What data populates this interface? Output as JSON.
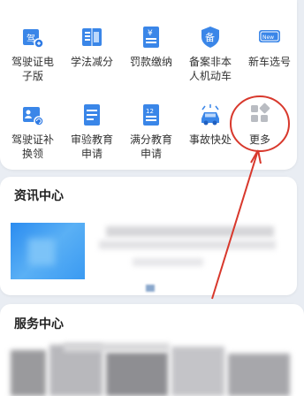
{
  "services": {
    "row1": [
      {
        "label_line1": "驾驶证电",
        "label_line2": "子版",
        "icon": "driving-license-card-icon"
      },
      {
        "label_line1": "学法减分",
        "label_line2": "",
        "icon": "book-icon"
      },
      {
        "label_line1": "罚款缴纳",
        "label_line2": "",
        "icon": "fine-payment-icon"
      },
      {
        "label_line1": "备案非本",
        "label_line2": "人机动车",
        "icon": "shield-icon"
      },
      {
        "label_line1": "新车选号",
        "label_line2": "",
        "icon": "new-plate-icon"
      }
    ],
    "row2": [
      {
        "label_line1": "驾驶证补",
        "label_line2": "换领",
        "icon": "license-replace-icon"
      },
      {
        "label_line1": "审验教育",
        "label_line2": "申请",
        "icon": "document-icon"
      },
      {
        "label_line1": "满分教育",
        "label_line2": "申请",
        "icon": "calendar-document-icon"
      },
      {
        "label_line1": "事故快处",
        "label_line2": "",
        "icon": "car-accident-icon"
      },
      {
        "label_line1": "更多",
        "label_line2": "",
        "icon": "more-grid-icon"
      }
    ],
    "new_badge": "New",
    "fine_symbol": "¥",
    "calendar_number": "12",
    "shield_char": "备"
  },
  "news_center": {
    "title": "资讯中心"
  },
  "service_center": {
    "title": "服务中心"
  },
  "colors": {
    "accent": "#2f7be5",
    "annotation": "#d8382c"
  }
}
